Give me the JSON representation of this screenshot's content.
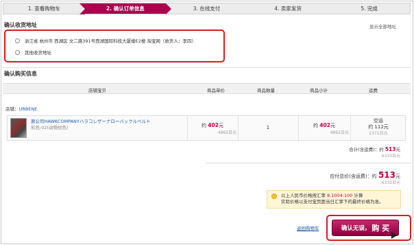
{
  "steps": [
    {
      "label": "1. 查看购物车"
    },
    {
      "label": "2. 确认订单信息"
    },
    {
      "label": "3. 在线支付"
    },
    {
      "label": "4. 卖家发货"
    },
    {
      "label": "5. 完成"
    }
  ],
  "address": {
    "title": "确认收货地址",
    "show_all": "显示全部地址",
    "option1": "浙江省 杭州市 西湖区 文二路391号西湖国际科技大厦楼E2楼 淘宝网（收货人：李四）",
    "option2": "其他收货地址"
  },
  "purchase": {
    "title": "确认购买信息",
    "columns": [
      "店铺宝贝",
      "商品单价",
      "商品数量",
      "商品小计",
      "运费"
    ],
    "shop_label": "店铺：",
    "shop_name": "URBENE",
    "item_title": "原公司HAWKCOMPANYハラコレザーナローバックルベルト",
    "item_color": "彩色:02(动物纹色)",
    "unit_price_prefix": "约",
    "unit_price": "402",
    "unit_price_suffix": "元",
    "unit_price_yen": "4962日元",
    "quantity": "1",
    "subtotal_prefix": "约",
    "subtotal_price": "402",
    "subtotal_suffix": "元",
    "subtotal_yen": "4962日元",
    "shipping_method": "空运",
    "shipping_prefix": "约",
    "shipping_price": "112",
    "shipping_suffix": "元",
    "shipping_yen": "1371日元"
  },
  "sums": {
    "subtotal_label": "合计(含运费)：约",
    "subtotal_value": "513",
    "subtotal_unit": "元",
    "subtotal_yen": "6333日元",
    "total_label": "应付总价(含运费)：约",
    "total_value": "513",
    "total_unit": "元",
    "total_yen": "6333日元"
  },
  "note": {
    "line1_prefix": "以上人民币价格按汇率",
    "rate": "8.1004:100",
    "line1_suffix": "计算",
    "line2": "实际价格以支付宝页面当日汇率下的最终价格为准。"
  },
  "actions": {
    "back": "返回购物车",
    "buy_prefix": "确认无误，",
    "buy_large": "购 买"
  },
  "colors": {
    "accent": "#a8004f",
    "highlight_box": "#d81b1b",
    "link": "#1a5aa0",
    "price": "#c0003a"
  }
}
